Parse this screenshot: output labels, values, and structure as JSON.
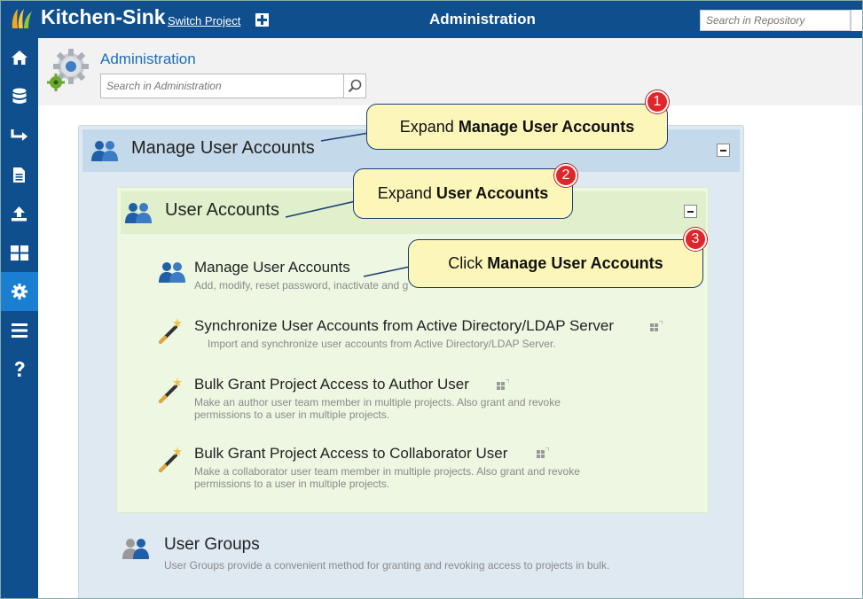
{
  "topbar": {
    "project_name": "Kitchen-Sink",
    "switch_project": "Switch Project",
    "title": "Administration",
    "search_placeholder": "Search in Repository"
  },
  "leftnav": {
    "items": [
      {
        "icon": "home-icon"
      },
      {
        "icon": "database-icon"
      },
      {
        "icon": "arrow-turn-icon"
      },
      {
        "icon": "document-icon"
      },
      {
        "icon": "upload-icon"
      },
      {
        "icon": "grid-icon"
      },
      {
        "icon": "gear-icon",
        "active": true
      },
      {
        "icon": "menu-icon"
      },
      {
        "icon": "help-icon"
      }
    ]
  },
  "header": {
    "title": "Administration",
    "search_placeholder": "Search in Administration"
  },
  "section": {
    "title": "Manage User Accounts",
    "subsection": {
      "title": "User Accounts",
      "items": [
        {
          "title": "Manage User Accounts",
          "desc": "Add, modify, reset password, inactivate and g"
        },
        {
          "title": "Synchronize User Accounts from Active Directory/LDAP Server",
          "desc": "Import and synchronize user accounts from Active Directory/LDAP Server."
        },
        {
          "title": "Bulk Grant Project Access to Author User",
          "desc_line1": "Make an author user team member in multiple projects. Also grant and revoke",
          "desc_line2": "permissions to a user in multiple projects."
        },
        {
          "title": "Bulk Grant Project Access to Collaborator User",
          "desc_line1": "Make a collaborator user team member in multiple projects. Also grant and revoke",
          "desc_line2": "permissions to a user in multiple projects."
        }
      ]
    },
    "groups": {
      "title": "User Groups",
      "desc": "User Groups  provide a convenient method for granting and revoking access to projects in bulk."
    }
  },
  "callouts": [
    {
      "number": "1",
      "prefix": "Expand ",
      "bold": "Manage User Accounts"
    },
    {
      "number": "2",
      "prefix": "Expand ",
      "bold": "User Accounts"
    },
    {
      "number": "3",
      "prefix": "Click ",
      "bold": "Manage User Accounts"
    }
  ],
  "colors": {
    "topbar": "#0f4f8e",
    "active_nav": "#1a7fd1",
    "callout_fill": "#fdf6b9",
    "badge": "#e0262b"
  }
}
